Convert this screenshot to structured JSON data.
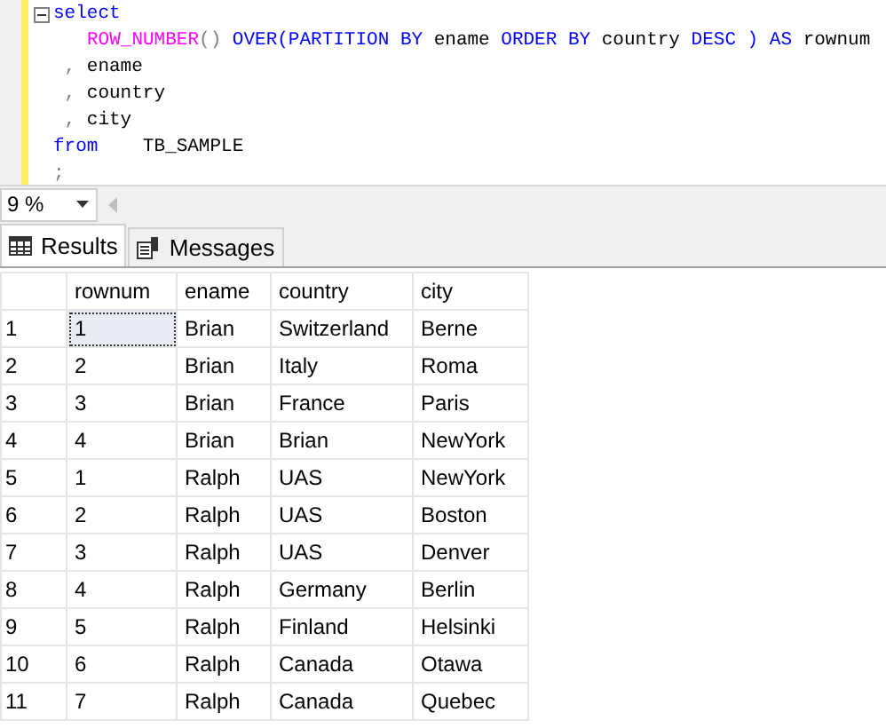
{
  "editor": {
    "lines": [
      {
        "tokens": [
          {
            "kind": "keyword",
            "text": "select"
          }
        ]
      },
      {
        "indent": true,
        "tokens": [
          {
            "kind": "function",
            "text": "ROW_NUMBER"
          },
          {
            "kind": "punct",
            "text": "()"
          },
          {
            "kind": "keyword",
            "text": " OVER(PARTITION BY"
          },
          {
            "kind": "plain",
            "text": " ename "
          },
          {
            "kind": "keyword",
            "text": "ORDER BY"
          },
          {
            "kind": "plain",
            "text": " country "
          },
          {
            "kind": "keyword",
            "text": "DESC ) AS"
          },
          {
            "kind": "plain",
            "text": " rownum"
          }
        ]
      },
      {
        "tokens": [
          {
            "kind": "punct",
            "text": " , "
          },
          {
            "kind": "plain",
            "text": "ename"
          }
        ]
      },
      {
        "tokens": [
          {
            "kind": "punct",
            "text": " , "
          },
          {
            "kind": "plain",
            "text": "country"
          }
        ]
      },
      {
        "tokens": [
          {
            "kind": "punct",
            "text": " , "
          },
          {
            "kind": "plain",
            "text": "city"
          }
        ]
      },
      {
        "tokens": [
          {
            "kind": "keyword",
            "text": "from"
          },
          {
            "kind": "plain",
            "text": "    TB_SAMPLE"
          }
        ]
      },
      {
        "tokens": [
          {
            "kind": "punct",
            "text": ";"
          }
        ]
      }
    ]
  },
  "zoom": {
    "value": "9 %"
  },
  "tabs": [
    {
      "label": "Results",
      "kind": "grid",
      "selected": true
    },
    {
      "label": "Messages",
      "kind": "messages",
      "selected": false
    }
  ],
  "grid": {
    "columns": [
      "rownum",
      "ename",
      "country",
      "city"
    ],
    "rows": [
      {
        "number": "1",
        "cells": [
          "1",
          "Brian",
          "Switzerland",
          "Berne"
        ],
        "current": true
      },
      {
        "number": "2",
        "cells": [
          "2",
          "Brian",
          "Italy",
          "Roma"
        ],
        "current": false
      },
      {
        "number": "3",
        "cells": [
          "3",
          "Brian",
          "France",
          "Paris"
        ],
        "current": false
      },
      {
        "number": "4",
        "cells": [
          "4",
          "Brian",
          "Brian",
          "NewYork"
        ],
        "current": false
      },
      {
        "number": "5",
        "cells": [
          "1",
          "Ralph",
          "UAS",
          "NewYork"
        ],
        "current": false
      },
      {
        "number": "6",
        "cells": [
          "2",
          "Ralph",
          "UAS",
          "Boston"
        ],
        "current": false
      },
      {
        "number": "7",
        "cells": [
          "3",
          "Ralph",
          "UAS",
          "Denver"
        ],
        "current": false
      },
      {
        "number": "8",
        "cells": [
          "4",
          "Ralph",
          "Germany",
          "Berlin"
        ],
        "current": false
      },
      {
        "number": "9",
        "cells": [
          "5",
          "Ralph",
          "Finland",
          "Helsinki"
        ],
        "current": false
      },
      {
        "number": "10",
        "cells": [
          "6",
          "Ralph",
          "Canada",
          "Otawa"
        ],
        "current": false
      },
      {
        "number": "11",
        "cells": [
          "7",
          "Ralph",
          "Canada",
          "Quebec"
        ],
        "current": false
      }
    ]
  }
}
